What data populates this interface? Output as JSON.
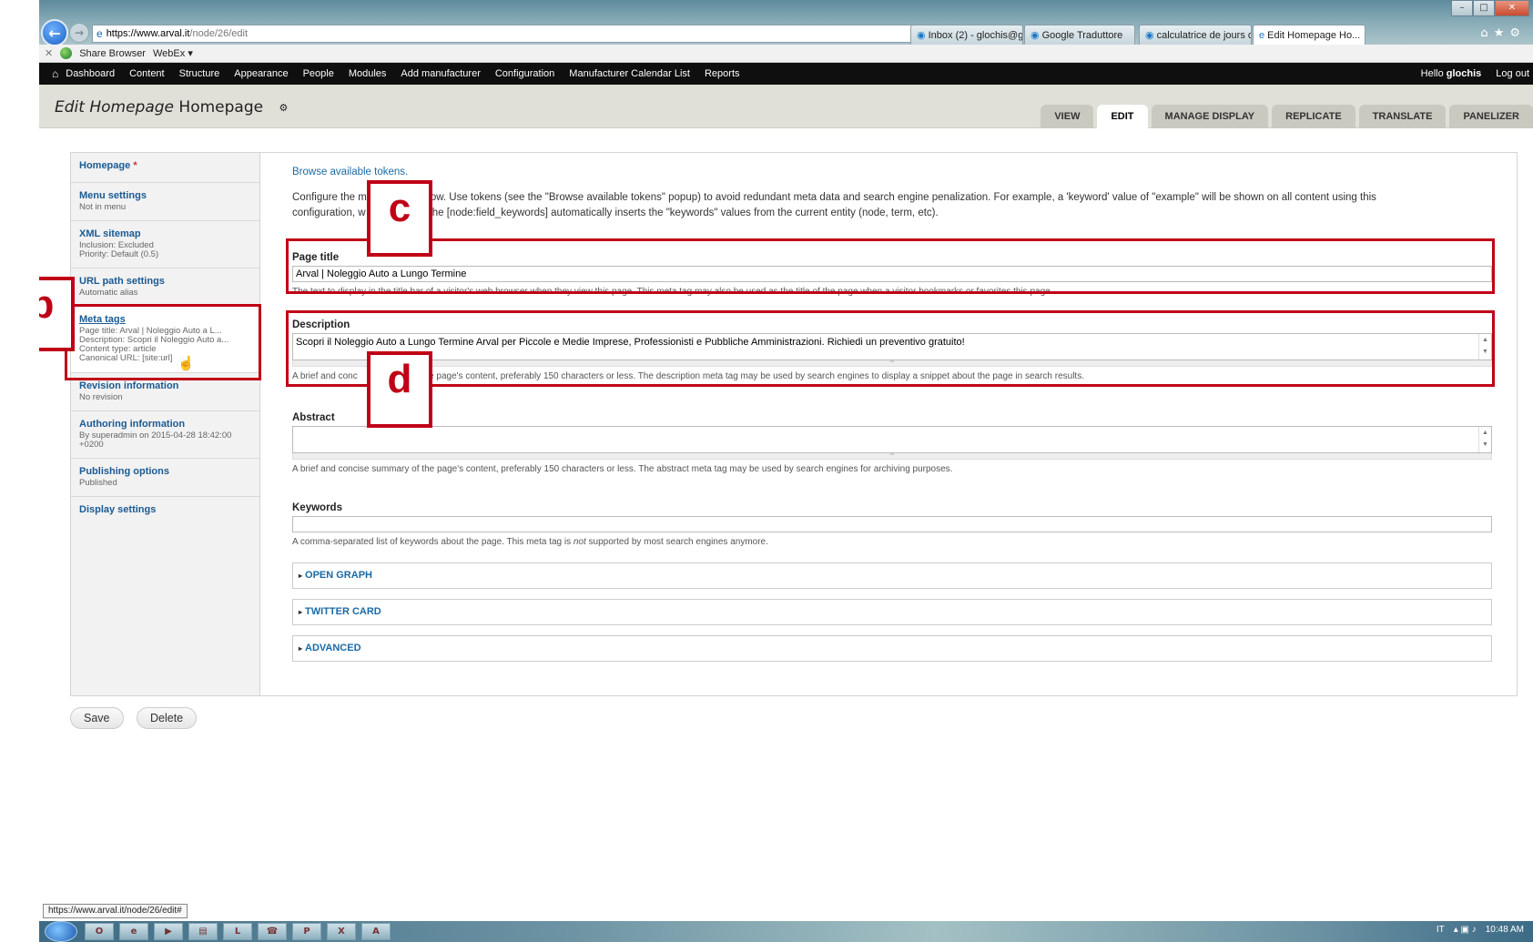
{
  "browser": {
    "url_scheme": "https://",
    "url_domain": "www.arval.it",
    "url_path": "/node/26/edit",
    "url_tools": "⚲ ▾ 🔒 ☰ ↻ ✕",
    "tabs": [
      {
        "label": "Inbox (2) - glochis@g..."
      },
      {
        "label": "Google Traduttore"
      },
      {
        "label": "calculatrice de jours o..."
      },
      {
        "label": "Edit Homepage Ho..."
      }
    ],
    "toolbar": {
      "share": "Share Browser",
      "webex": "WebEx"
    }
  },
  "admin_menu": {
    "items": [
      "Dashboard",
      "Content",
      "Structure",
      "Appearance",
      "People",
      "Modules",
      "Add manufacturer",
      "Configuration",
      "Manufacturer Calendar List",
      "Reports"
    ],
    "hello_prefix": "Hello",
    "username": "glochis",
    "logout": "Log out"
  },
  "page": {
    "title_italic": "Edit Homepage",
    "title_rest": "Homepage",
    "tabs": [
      "VIEW",
      "EDIT",
      "MANAGE DISPLAY",
      "REPLICATE",
      "TRANSLATE",
      "PANELIZER"
    ]
  },
  "vertical_tabs": [
    {
      "label": "Homepage",
      "required": "*",
      "summary": ""
    },
    {
      "label": "Menu settings",
      "summary": "Not in menu"
    },
    {
      "label": "XML sitemap",
      "summary": "Inclusion: Excluded",
      "summary2": "Priority: Default (0.5)"
    },
    {
      "label": "URL path settings",
      "summary": "Automatic alias"
    },
    {
      "label": "Meta tags",
      "summary": "Page title: Arval | Noleggio Auto a L...",
      "summary2": "Description: Scopri il Noleggio Auto a...",
      "summary3": "Content type: article",
      "summary4": "Canonical URL: [site:url]"
    },
    {
      "label": "Revision information",
      "summary": "No revision"
    },
    {
      "label": "Authoring information",
      "summary": "By superadmin on 2015-04-28 18:42:00",
      "summary2": "+0200"
    },
    {
      "label": "Publishing options",
      "summary": "Published"
    },
    {
      "label": "Display settings"
    }
  ],
  "meta": {
    "tokens_link": "Browse available tokens.",
    "intro_a": "Configure the m",
    "intro_b": "ow. Use tokens (see the \"Browse available tokens\" popup) to avoid redundant meta data and search engine penalization. For example, a 'keyword' value of \"example\" will be shown on all content using this",
    "intro_c": "configuration, w",
    "intro_d": "the [node:field_keywords] automatically inserts the \"keywords\" values from the current entity (node, term, etc).",
    "page_title": {
      "label": "Page title",
      "value": "Arval | Noleggio Auto a Lungo Termine",
      "desc": "The text to display in the title bar of a visitor's web browser when they view this page. This meta tag may also be used as the title of the page when a visitor bookmarks or favorites this page."
    },
    "description": {
      "label": "Description",
      "value": "Scopri il Noleggio Auto a Lungo Termine Arval per Piccole e Medie Imprese, Professionisti e Pubbliche Amministrazioni. Richiedi un preventivo gratuito!",
      "desc_a": "A brief and conc",
      "desc_b": "the page's content, preferably 150 characters or less. The description meta tag may be used by search engines to display a snippet about the page in search results."
    },
    "abstract": {
      "label": "Abstract",
      "value": "",
      "desc": "A brief and concise summary of the page's content, preferably 150 characters or less. The abstract meta tag may be used by search engines for archiving purposes."
    },
    "keywords": {
      "label": "Keywords",
      "value": "",
      "desc_a": "A comma-separated list of keywords about the page. This meta tag is ",
      "desc_em": "not",
      "desc_b": " supported by most search engines anymore."
    },
    "fieldsets": [
      "OPEN GRAPH",
      "TWITTER CARD",
      "ADVANCED"
    ]
  },
  "actions": {
    "save": "Save",
    "delete": "Delete"
  },
  "annotations": {
    "b": "b",
    "c": "c",
    "d": "d"
  },
  "status_url": "https://www.arval.it/node/26/edit#",
  "tray": {
    "lang": "IT",
    "time": "10:48 AM"
  },
  "colors": {
    "annotation_red": "#c00016",
    "link_blue": "#1a5a93",
    "admin_bar": "#0f0f0f"
  }
}
